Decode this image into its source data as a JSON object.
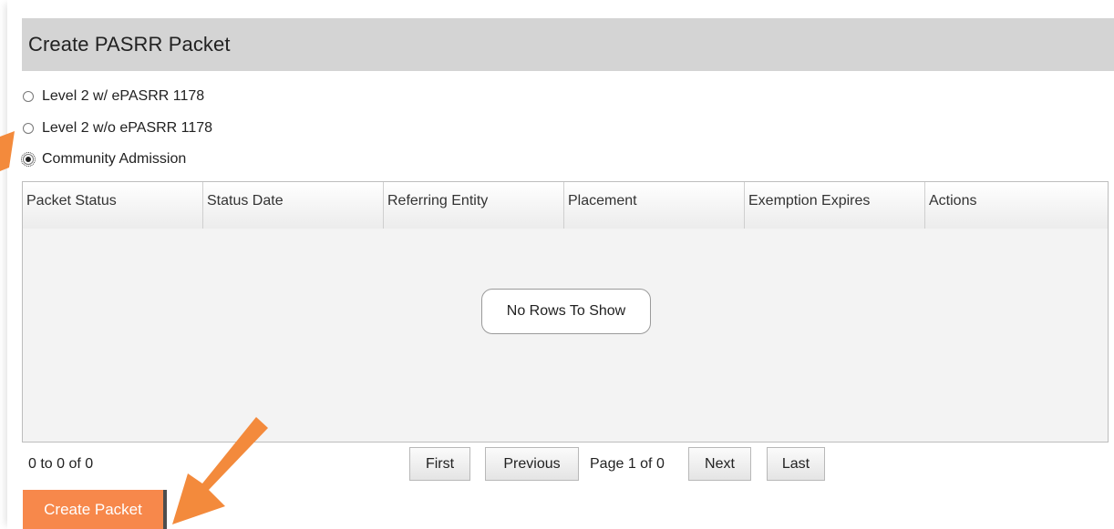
{
  "panel": {
    "title": "Create PASRR Packet"
  },
  "packet_types": [
    {
      "label": "Level 2 w/ ePASRR 1178",
      "selected": false
    },
    {
      "label": "Level 2 w/o ePASRR 1178",
      "selected": false
    },
    {
      "label": "Community Admission",
      "selected": true
    }
  ],
  "grid": {
    "columns": [
      "Packet Status",
      "Status Date",
      "Referring Entity",
      "Placement",
      "Exemption Expires",
      "Actions"
    ],
    "rows": [],
    "empty_message": "No Rows To Show"
  },
  "pager": {
    "summary": "0 to 0 of 0",
    "first": "First",
    "previous": "Previous",
    "page_info": "Page 1 of 0",
    "next": "Next",
    "last": "Last"
  },
  "actions": {
    "create_label": "Create Packet"
  },
  "colors": {
    "accent": "#f7884b",
    "header_bg": "#d4d4d4",
    "annotation_arrow": "#f38a3c"
  }
}
